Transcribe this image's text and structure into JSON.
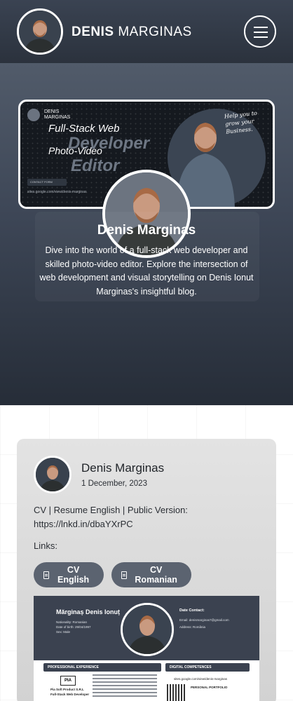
{
  "header": {
    "brand_first": "DENIS",
    "brand_last": "MARGINAS",
    "menu_icon": "hamburger-icon"
  },
  "hero": {
    "cover": {
      "brand_first": "DENIS",
      "brand_last": "MARGINAS",
      "line1": "Full-Stack Web",
      "line2": "Developer",
      "line3": "Photo-Video",
      "line4": "Editor",
      "button": "CONTACT FORM",
      "url": "sites.google.com/view/denis-marginas",
      "script": "Help you to grow your Business."
    },
    "name": "Denis Marginas",
    "description": "Dive into the world of a full-stack web developer and skilled photo-video editor. Explore the intersection of web development and visual storytelling on Denis Ionut Marginas's insightful blog."
  },
  "post": {
    "author": "Denis Marginas",
    "date": "1 December, 2023",
    "text": "CV | Resume English | Public Version: https://lnkd.in/dbaYXrPC",
    "links_label": "Links:",
    "buttons": [
      {
        "label": "CV English",
        "icon": "document-icon"
      },
      {
        "label": "CV Romanian",
        "icon": "document-icon"
      }
    ],
    "cv_preview": {
      "name": "Mărginaș Denis Ionuț",
      "meta": [
        "Nationality: Romanian",
        "Date of birth: 29/04/1997",
        "Sex: Male"
      ],
      "contact_title": "Date Contact:",
      "contact_lines": [
        "Email: denismarginas7@gmail.com",
        "Address: România"
      ],
      "section_left": "PROFESSIONAL EXPERIENCE",
      "section_right": "DIGITAL COMPETENCES",
      "logo": "PIA",
      "company": "Pia Soft Product S.R.L",
      "role": "Full-Stack Web Developer",
      "site": "sites.google.com/view/denis-marginas",
      "portfolio": "PERSONAL PORTFOLIO"
    }
  },
  "colors": {
    "header_bg": "#2f3642",
    "hero_bg": "#3d4656",
    "card_bg": "#dcdcdc",
    "pill_bg": "#5b6370"
  }
}
